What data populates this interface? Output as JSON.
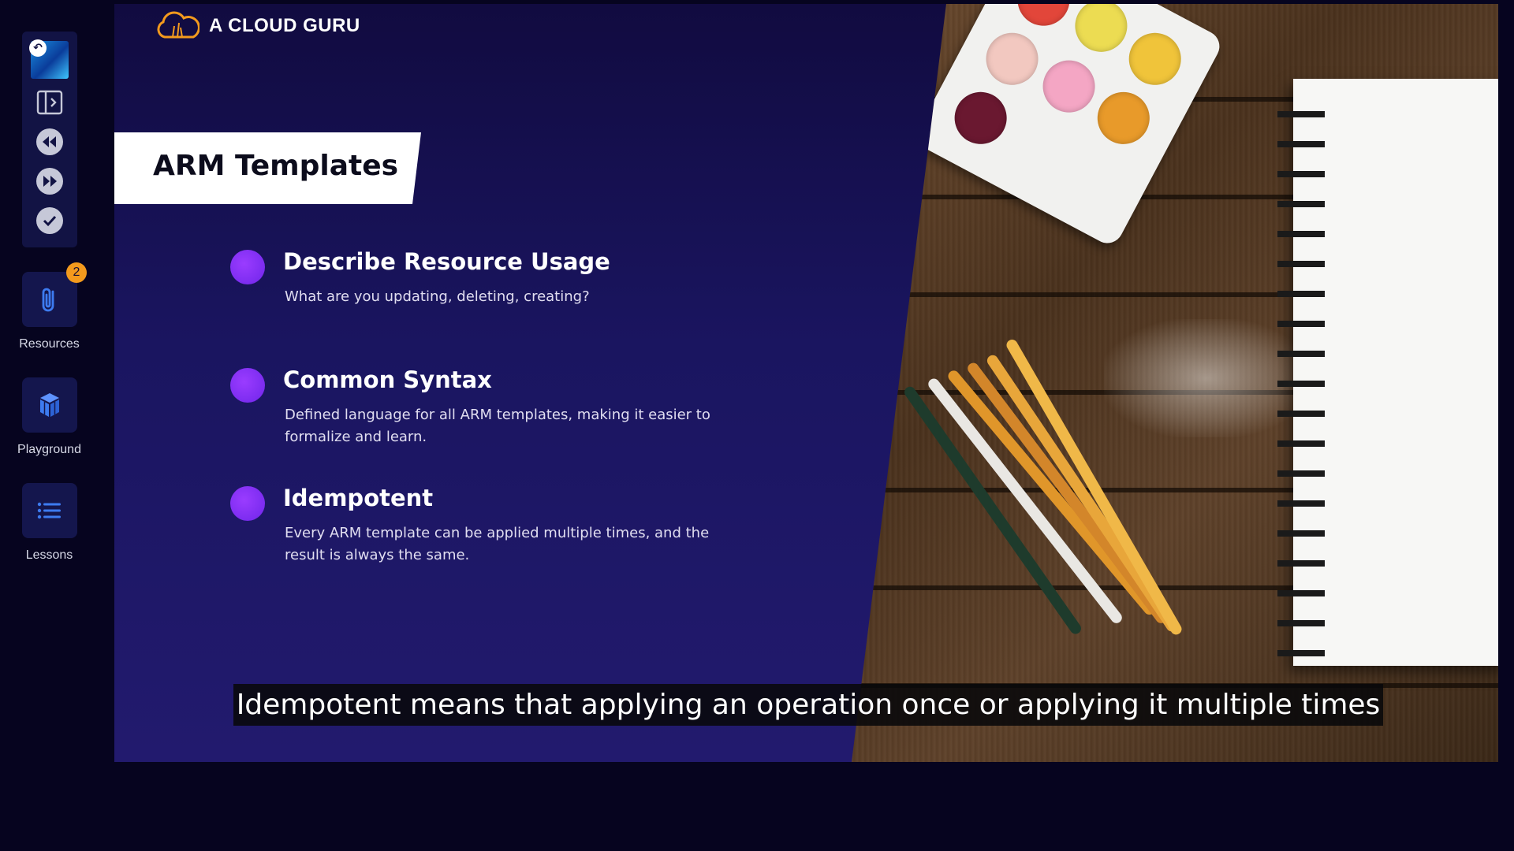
{
  "brand": {
    "name": "A CLOUD GURU",
    "accent_color": "#f39a1d"
  },
  "sidebar": {
    "controls": [
      {
        "name": "video-thumbnail",
        "icon": "back-arrow-icon"
      },
      {
        "name": "expand-sidebar-button",
        "icon": "expand-panel-icon"
      },
      {
        "name": "rewind-button",
        "icon": "rewind-icon"
      },
      {
        "name": "fast-forward-button",
        "icon": "fast-forward-icon"
      },
      {
        "name": "mark-complete-button",
        "icon": "checkmark-icon"
      }
    ],
    "resources": {
      "label": "Resources",
      "badge": "2",
      "icon": "paperclip-icon"
    },
    "playground": {
      "label": "Playground",
      "icon": "cubes-icon"
    },
    "lessons": {
      "label": "Lessons",
      "icon": "list-icon"
    }
  },
  "slide": {
    "title": "ARM Templates",
    "bullet_color": "#7c2cf0",
    "items": [
      {
        "title": "Describe Resource Usage",
        "desc": "What are you updating, deleting, creating?"
      },
      {
        "title": "Common Syntax",
        "desc": "Defined language for all ARM templates, making it easier to formalize and learn."
      },
      {
        "title": "Idempotent",
        "desc": "Every ARM template can be applied multiple times, and the result is always the same."
      }
    ]
  },
  "caption": {
    "text": "Idempotent means that applying an operation once or applying it multiple times"
  }
}
